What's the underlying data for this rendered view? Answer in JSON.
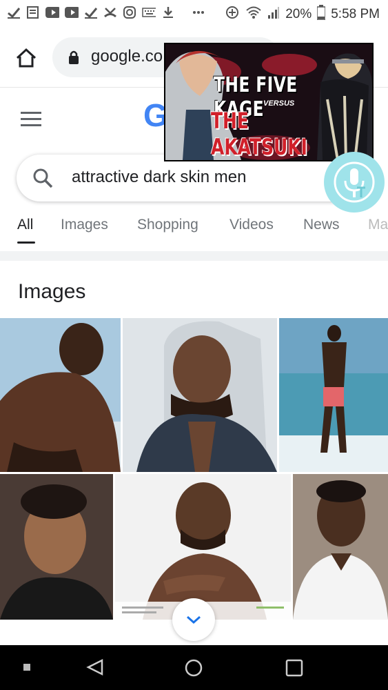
{
  "status_bar": {
    "battery_percent": "20%",
    "time": "5:58 PM",
    "notification_icons": [
      "check-icon",
      "news-icon",
      "youtube-icon",
      "youtube-icon",
      "check-icon",
      "missed-call-icon",
      "instagram-icon",
      "keyboard-icon",
      "download-icon",
      "more-dots-icon"
    ],
    "system_icons": [
      "data-saver-icon",
      "wifi-icon",
      "signal-icon",
      "battery-icon"
    ]
  },
  "browser": {
    "url": "google.co"
  },
  "overlay_video": {
    "line1": "THE FIVE KAGE",
    "line2": "VERSUS",
    "line3": "THE AKATSUKI"
  },
  "google": {
    "logo_partial": "G",
    "search_query": "attractive dark skin men"
  },
  "tabs": [
    {
      "label": "All",
      "active": true
    },
    {
      "label": "Images"
    },
    {
      "label": "Shopping"
    },
    {
      "label": "Videos"
    },
    {
      "label": "News"
    },
    {
      "label": "Ma"
    }
  ],
  "images_section": {
    "title": "Images"
  },
  "colors": {
    "accent_blue": "#4285f4",
    "mic_bubble": "#9fe3ea",
    "overlay_red": "#d1202a"
  }
}
